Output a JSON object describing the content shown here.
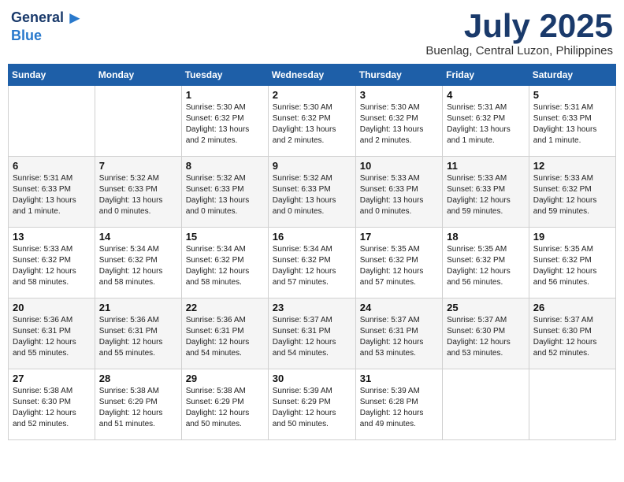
{
  "header": {
    "logo_line1": "General",
    "logo_line2": "Blue",
    "month_title": "July 2025",
    "location": "Buenlag, Central Luzon, Philippines"
  },
  "columns": [
    "Sunday",
    "Monday",
    "Tuesday",
    "Wednesday",
    "Thursday",
    "Friday",
    "Saturday"
  ],
  "weeks": [
    [
      {
        "day": "",
        "content": ""
      },
      {
        "day": "",
        "content": ""
      },
      {
        "day": "1",
        "content": "Sunrise: 5:30 AM\nSunset: 6:32 PM\nDaylight: 13 hours\nand 2 minutes."
      },
      {
        "day": "2",
        "content": "Sunrise: 5:30 AM\nSunset: 6:32 PM\nDaylight: 13 hours\nand 2 minutes."
      },
      {
        "day": "3",
        "content": "Sunrise: 5:30 AM\nSunset: 6:32 PM\nDaylight: 13 hours\nand 2 minutes."
      },
      {
        "day": "4",
        "content": "Sunrise: 5:31 AM\nSunset: 6:32 PM\nDaylight: 13 hours\nand 1 minute."
      },
      {
        "day": "5",
        "content": "Sunrise: 5:31 AM\nSunset: 6:33 PM\nDaylight: 13 hours\nand 1 minute."
      }
    ],
    [
      {
        "day": "6",
        "content": "Sunrise: 5:31 AM\nSunset: 6:33 PM\nDaylight: 13 hours\nand 1 minute."
      },
      {
        "day": "7",
        "content": "Sunrise: 5:32 AM\nSunset: 6:33 PM\nDaylight: 13 hours\nand 0 minutes."
      },
      {
        "day": "8",
        "content": "Sunrise: 5:32 AM\nSunset: 6:33 PM\nDaylight: 13 hours\nand 0 minutes."
      },
      {
        "day": "9",
        "content": "Sunrise: 5:32 AM\nSunset: 6:33 PM\nDaylight: 13 hours\nand 0 minutes."
      },
      {
        "day": "10",
        "content": "Sunrise: 5:33 AM\nSunset: 6:33 PM\nDaylight: 13 hours\nand 0 minutes."
      },
      {
        "day": "11",
        "content": "Sunrise: 5:33 AM\nSunset: 6:33 PM\nDaylight: 12 hours\nand 59 minutes."
      },
      {
        "day": "12",
        "content": "Sunrise: 5:33 AM\nSunset: 6:32 PM\nDaylight: 12 hours\nand 59 minutes."
      }
    ],
    [
      {
        "day": "13",
        "content": "Sunrise: 5:33 AM\nSunset: 6:32 PM\nDaylight: 12 hours\nand 58 minutes."
      },
      {
        "day": "14",
        "content": "Sunrise: 5:34 AM\nSunset: 6:32 PM\nDaylight: 12 hours\nand 58 minutes."
      },
      {
        "day": "15",
        "content": "Sunrise: 5:34 AM\nSunset: 6:32 PM\nDaylight: 12 hours\nand 58 minutes."
      },
      {
        "day": "16",
        "content": "Sunrise: 5:34 AM\nSunset: 6:32 PM\nDaylight: 12 hours\nand 57 minutes."
      },
      {
        "day": "17",
        "content": "Sunrise: 5:35 AM\nSunset: 6:32 PM\nDaylight: 12 hours\nand 57 minutes."
      },
      {
        "day": "18",
        "content": "Sunrise: 5:35 AM\nSunset: 6:32 PM\nDaylight: 12 hours\nand 56 minutes."
      },
      {
        "day": "19",
        "content": "Sunrise: 5:35 AM\nSunset: 6:32 PM\nDaylight: 12 hours\nand 56 minutes."
      }
    ],
    [
      {
        "day": "20",
        "content": "Sunrise: 5:36 AM\nSunset: 6:31 PM\nDaylight: 12 hours\nand 55 minutes."
      },
      {
        "day": "21",
        "content": "Sunrise: 5:36 AM\nSunset: 6:31 PM\nDaylight: 12 hours\nand 55 minutes."
      },
      {
        "day": "22",
        "content": "Sunrise: 5:36 AM\nSunset: 6:31 PM\nDaylight: 12 hours\nand 54 minutes."
      },
      {
        "day": "23",
        "content": "Sunrise: 5:37 AM\nSunset: 6:31 PM\nDaylight: 12 hours\nand 54 minutes."
      },
      {
        "day": "24",
        "content": "Sunrise: 5:37 AM\nSunset: 6:31 PM\nDaylight: 12 hours\nand 53 minutes."
      },
      {
        "day": "25",
        "content": "Sunrise: 5:37 AM\nSunset: 6:30 PM\nDaylight: 12 hours\nand 53 minutes."
      },
      {
        "day": "26",
        "content": "Sunrise: 5:37 AM\nSunset: 6:30 PM\nDaylight: 12 hours\nand 52 minutes."
      }
    ],
    [
      {
        "day": "27",
        "content": "Sunrise: 5:38 AM\nSunset: 6:30 PM\nDaylight: 12 hours\nand 52 minutes."
      },
      {
        "day": "28",
        "content": "Sunrise: 5:38 AM\nSunset: 6:29 PM\nDaylight: 12 hours\nand 51 minutes."
      },
      {
        "day": "29",
        "content": "Sunrise: 5:38 AM\nSunset: 6:29 PM\nDaylight: 12 hours\nand 50 minutes."
      },
      {
        "day": "30",
        "content": "Sunrise: 5:39 AM\nSunset: 6:29 PM\nDaylight: 12 hours\nand 50 minutes."
      },
      {
        "day": "31",
        "content": "Sunrise: 5:39 AM\nSunset: 6:28 PM\nDaylight: 12 hours\nand 49 minutes."
      },
      {
        "day": "",
        "content": ""
      },
      {
        "day": "",
        "content": ""
      }
    ]
  ]
}
